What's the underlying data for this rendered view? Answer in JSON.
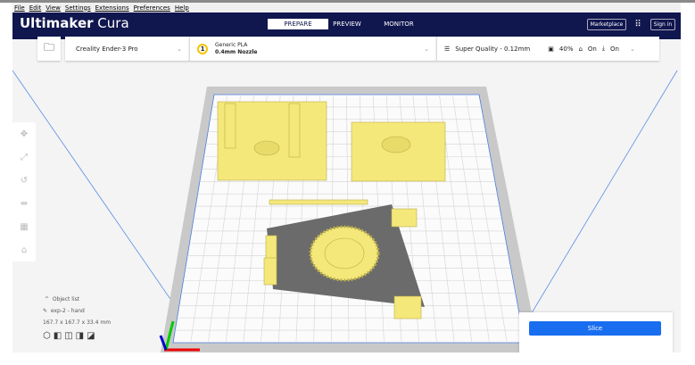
{
  "menu": [
    "File",
    "Edit",
    "View",
    "Settings",
    "Extensions",
    "Preferences",
    "Help"
  ],
  "header": {
    "logo_bold": "Ultimaker",
    "logo_light": " Cura",
    "tabs": [
      "PREPARE",
      "PREVIEW",
      "MONITOR"
    ],
    "marketplace": "Marketplace",
    "signin": "Sign in"
  },
  "toolbar": {
    "printer": "Creality Ender-3 Pro",
    "extruder_num": "1",
    "material": "Generic PLA",
    "nozzle": "0.4mm Nozzle",
    "profile": "Super Quality - 0.12mm",
    "infill": "40%",
    "support": "On",
    "adhesion": "On"
  },
  "objects": {
    "title": "Object list",
    "name": "exp-2 - hand",
    "dims": "167.7 x 167.7 x 33.4 mm"
  },
  "slice": {
    "label": "Slice"
  },
  "colors": {
    "header": "#10164e",
    "accent": "#196ef0",
    "model": "#f5e87a"
  }
}
